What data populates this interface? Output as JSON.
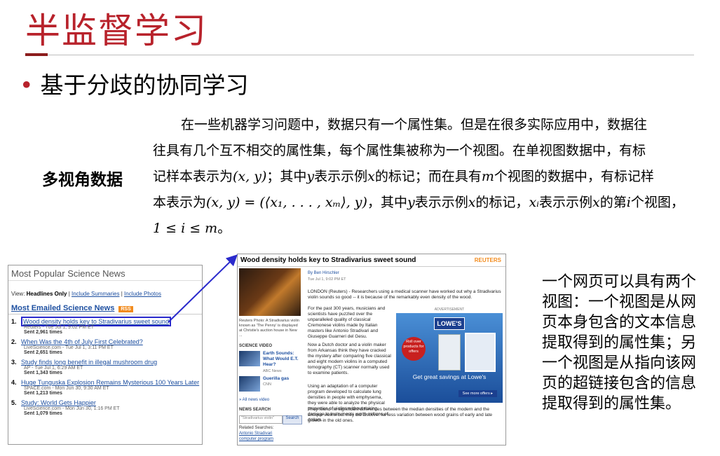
{
  "slide": {
    "title": "半监督学习",
    "bullet": "基于分歧的协同学习",
    "side_label": "多视角数据",
    "paragraph": {
      "line1": "在一些机器学习问题中，数据只有一个属性集。但是在很多实际应用中，数据往",
      "line2": "往具有几个互不相交的属性集，每个属性集被称为一个视图。在单视图数据中，有标",
      "line3a": "记样本表示为",
      "line3_math1": "(x, y)",
      "line3b": "；其中",
      "line3_math2": "y",
      "line3c": "表示示例",
      "line3_math3": "x",
      "line3d": "的标记；而在具有",
      "line3_math4": "m",
      "line3e": "个视图的数据中，有标记样",
      "line4a": "本表示为",
      "line4_math1": "(x, y) = (⟨x₁, . . . , xₘ⟩, y)",
      "line4b": "，其中",
      "line4_math2": "y",
      "line4c": "表示示例",
      "line4_math3": "x",
      "line4d": "的标记，",
      "line4_math4": "xᵢ",
      "line4e": "表示示例",
      "line4_math5": "x",
      "line4f": "的第",
      "line4_math6": "i",
      "line4g": "个视图，",
      "line5_math": "1 ≤ i ≤ m",
      "line5_end": "。"
    },
    "right_text": "一个网页可以具有两个视图：一个视图是从网页本身包含的文本信息提取得到的属性集；另一个视图是从指向该网页的超链接包含的信息提取得到的属性集。"
  },
  "left_panel": {
    "header": "Most Popular Science News",
    "view_prefix": "View:",
    "view_headlines": "Headlines Only",
    "view_sep1": "|",
    "view_summaries": "Include Summaries",
    "view_sep2": "|",
    "view_photos": "Include Photos",
    "section": "Most Emailed Science News",
    "rss": "RSS",
    "items": [
      {
        "num": "1.",
        "headline": "Wood density holds key to Stradivarius sweet sound",
        "meta": "Reuters - Tue Jul 1, 9:02 PM ET",
        "sent": "Sent 2,961 times"
      },
      {
        "num": "2.",
        "headline": "When Was the 4th of July First Celebrated?",
        "meta": "LiveScience.com - Tue Jul 1, 3:11 PM ET",
        "sent": "Sent 2,651 times"
      },
      {
        "num": "3.",
        "headline": "Study finds long benefit in illegal mushroom drug",
        "meta": "AP - Tue Jul 1, 6:29 AM ET",
        "sent": "Sent 1,343 times"
      },
      {
        "num": "4.",
        "headline": "Huge Tunguska Explosion Remains Mysterious 100 Years Later",
        "meta": "SPACE.com - Mon Jun 30, 9:30 AM ET",
        "sent": "Sent 1,213 times"
      },
      {
        "num": "5.",
        "headline": "Study: World Gets Happier",
        "meta": "LiveScience.com - Mon Jun 30, 1:16 PM ET",
        "sent": "Sent 1,079 times"
      }
    ]
  },
  "right_panel": {
    "title": "Wood density holds key to Stradivarius sweet sound",
    "source": "REUTERS",
    "byline": "By Ben Hirschler",
    "date": "Tue Jul 1, 9:02 PM ET",
    "lead": "LONDON (Reuters) - Researchers using a medical scanner have worked out why a Stradivarius violin sounds so good -- it is because of the remarkably even density of the wood.",
    "body1": "For the past 300 years, musicians and scientists have puzzled over the unparalleled quality of classical Cremonese violins made by Italian masters like Antonio Stradivari and Giuseppe Guarneri del Gesu.",
    "body2": "Now a Dutch doctor and a violin maker from Arkansas think they have cracked the mystery after comparing five classical and eight modern violins in a computed tomography (CT) scanner normally used to examine patients.",
    "body3": "Using an adaptation of a computer program developed to calculate lung densities in people with emphysema, they were able to analyze the physical properties of violins without risking damage to instruments worth millions of dollars.",
    "body4": "They found no significant differences between the median densities of the modern and the antique violins but they did discover far less variation between wood grains of early and late growth in the old ones.",
    "caption": "Reuters Photo: A Stradivarius violin known as 'The Penny' is displayed at Christie's auction house in New ...",
    "video_header": "SCIENCE VIDEO",
    "videos": [
      {
        "title": "Earth Sounds: What Would E.T. Hear?",
        "source": "ABC News"
      },
      {
        "title": "Guerilla gas",
        "source": "CNN"
      }
    ],
    "all_news_video": "» All news video",
    "news_search": "NEWS SEARCH",
    "search_placeholder": "\"Stradivarius violin\"",
    "search_button": "Search",
    "related_label": "Related Searches:",
    "related": [
      "Antonio Stradivari",
      "computer program"
    ],
    "ad": {
      "label": "ADVERTISEMENT",
      "brand": "LOWE'S",
      "badge": "Roll over products for offers",
      "tagline": "Get great savings at Lowe's",
      "cta": "See more offers ▸"
    }
  },
  "colors": {
    "title_red": "#b8222b",
    "link_blue": "#1d4fa0",
    "arrow_blue": "#2a2acc"
  }
}
